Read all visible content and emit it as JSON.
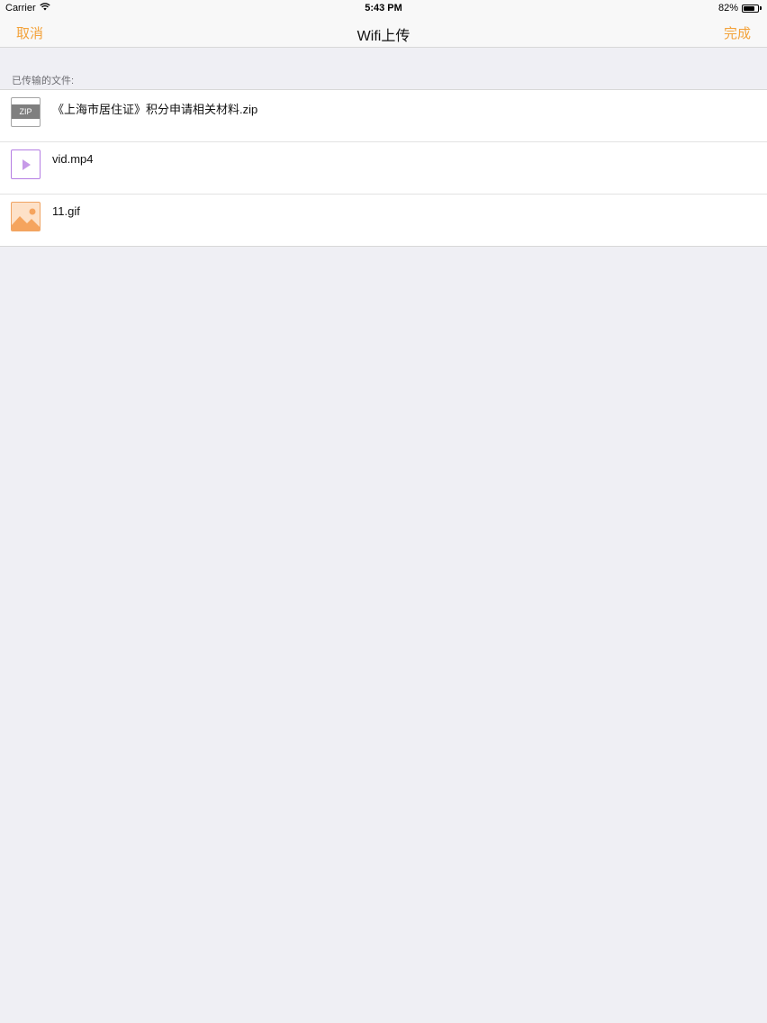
{
  "status_bar": {
    "carrier": "Carrier",
    "time": "5:43 PM",
    "battery_percent": "82%",
    "battery_level": 0.82
  },
  "nav": {
    "cancel_label": "取消",
    "title": "Wifi上传",
    "done_label": "完成",
    "accent_color": "#f3a23a"
  },
  "section": {
    "header": "已传输的文件:"
  },
  "files": [
    {
      "name": "《上海市居住证》积分申请相关材料.zip",
      "icon": "zip-file-icon",
      "icon_label": "ZIP"
    },
    {
      "name": "vid.mp4",
      "icon": "video-file-icon"
    },
    {
      "name": "11.gif",
      "icon": "image-file-icon"
    }
  ]
}
